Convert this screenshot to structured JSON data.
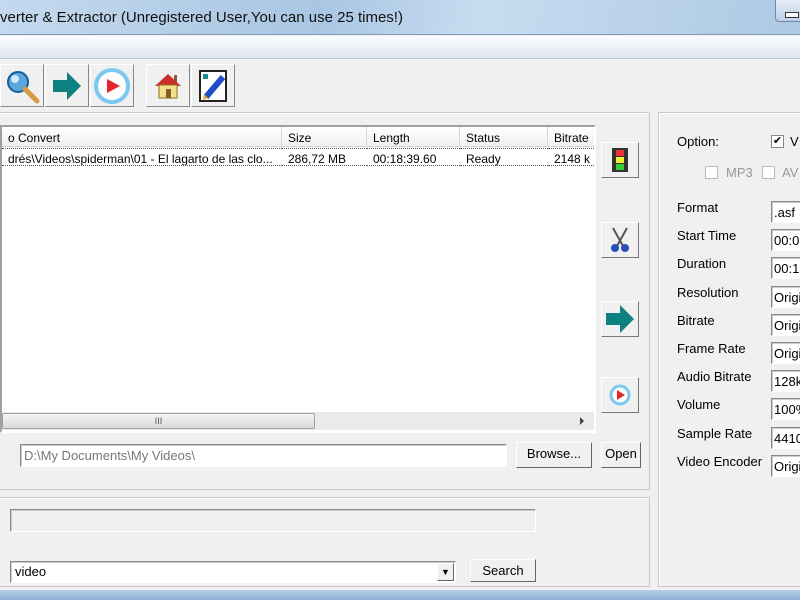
{
  "window": {
    "title": "verter & Extractor (Unregistered User,You can use 25 times!)"
  },
  "toolbar": {
    "buttons": [
      {
        "icon": "magnifier-icon"
      },
      {
        "icon": "arrow-right-icon"
      },
      {
        "icon": "play-icon"
      },
      {
        "icon": "home-icon"
      },
      {
        "icon": "edit-icon"
      }
    ]
  },
  "file_list": {
    "columns": [
      "o Convert",
      "Size",
      "Length",
      "Status",
      "Bitrate"
    ],
    "rows": [
      {
        "name": "drés\\Videos\\spiderman\\01 - El lagarto de las clo...",
        "size": "286,72 MB",
        "length": "00:18:39.60",
        "status": "Ready",
        "bitrate": "2148 k"
      }
    ],
    "scroll_grip": "III"
  },
  "output": {
    "path": "D:\\My Documents\\My Videos\\",
    "browse_label": "Browse...",
    "open_label": "Open"
  },
  "search": {
    "value": "video",
    "button_label": "Search"
  },
  "options": {
    "option_label": "Option:",
    "video_check": "V",
    "video_checked": true,
    "mp3_label": "MP3",
    "av_label": "AV",
    "fields": [
      {
        "label": "Format",
        "value": ".asf"
      },
      {
        "label": "Start Time",
        "value": "00:0"
      },
      {
        "label": "Duration",
        "value": "00:1"
      },
      {
        "label": "Resolution",
        "value": "Origi"
      },
      {
        "label": "Bitrate",
        "value": "Origi"
      },
      {
        "label": "Frame Rate",
        "value": "Origi"
      },
      {
        "label": "Audio Bitrate",
        "value": "128k"
      },
      {
        "label": "Volume",
        "value": "100%"
      },
      {
        "label": "Sample Rate",
        "value": "4410"
      },
      {
        "label": "Video Encoder",
        "value": "Origi"
      }
    ]
  }
}
